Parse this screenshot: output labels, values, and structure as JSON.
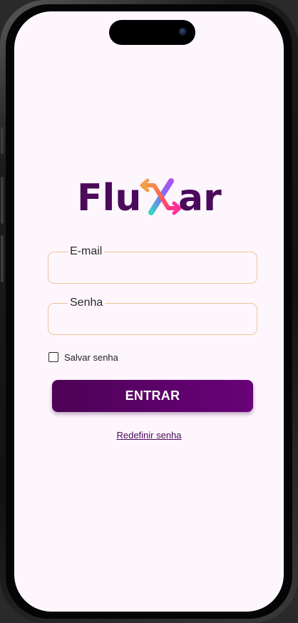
{
  "app": {
    "logo_text_left": "Flu",
    "logo_text_right": "ar",
    "logo_mark": "X",
    "brand_color": "#4b0a5a",
    "accent_colors": [
      "#f29f4b",
      "#a64ef0",
      "#ff2f7a",
      "#3ad3c4"
    ]
  },
  "form": {
    "email_label": "E-mail",
    "email_value": "",
    "password_label": "Senha",
    "password_value": "",
    "field_border_color": "#eec39a",
    "remember_label": "Salvar senha",
    "remember_checked": false,
    "submit_label": "ENTRAR",
    "submit_color": "#5e016c",
    "reset_link_label": "Redefinir senha"
  },
  "device": {
    "camera_icon": "camera-icon"
  }
}
